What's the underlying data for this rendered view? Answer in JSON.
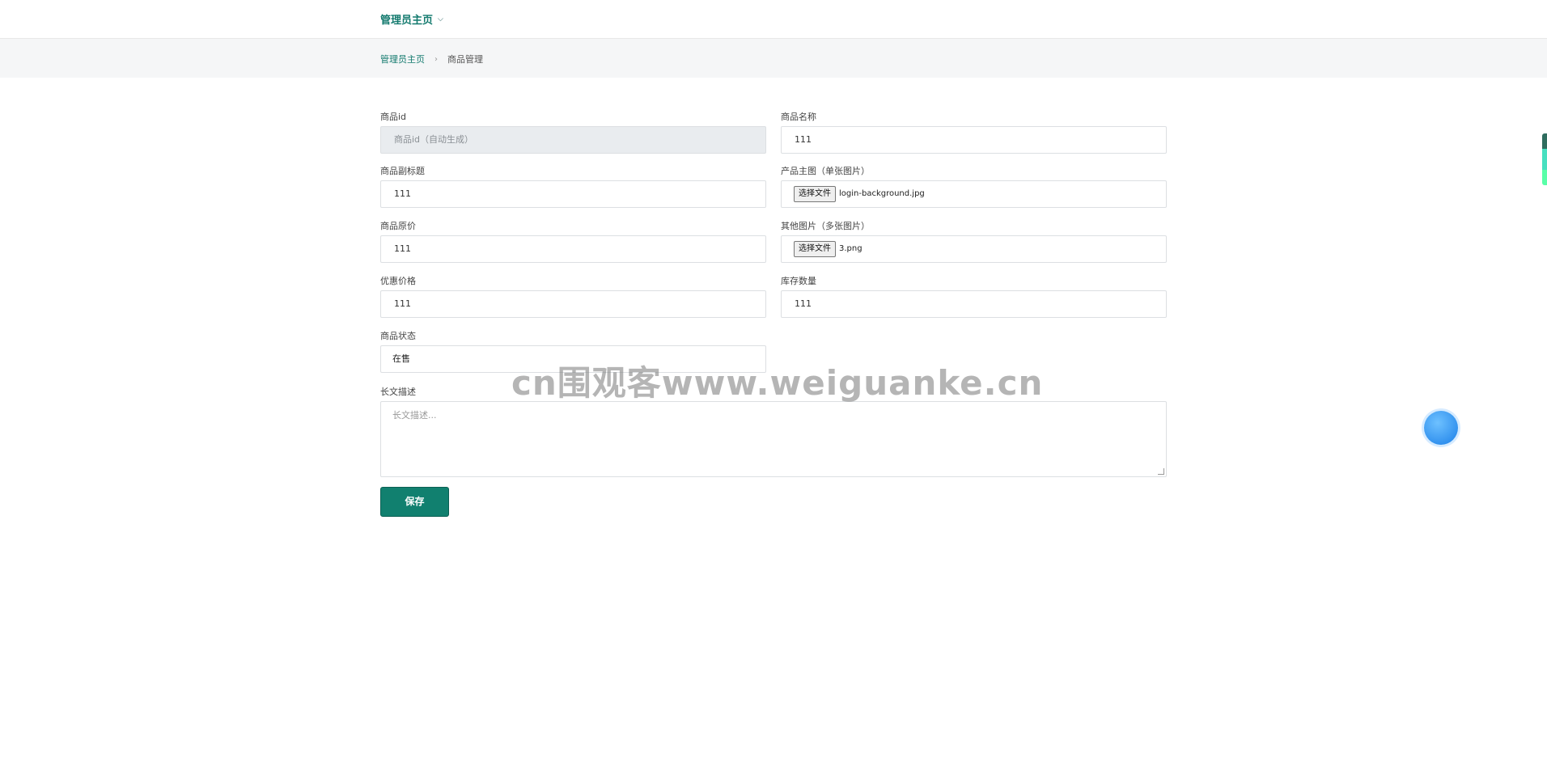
{
  "header": {
    "title": "管理员主页",
    "chevron_icon": "chevron-down-icon"
  },
  "breadcrumb": {
    "home": "管理员主页",
    "separator": "›",
    "current": "商品管理"
  },
  "form": {
    "product_id": {
      "label": "商品id",
      "placeholder": "商品id（自动生成）"
    },
    "product_name": {
      "label": "商品名称",
      "value": "111"
    },
    "subtitle": {
      "label": "商品副标题",
      "value": "111"
    },
    "main_image": {
      "label": "产品主图（单张图片）",
      "button": "选择文件",
      "file": "login-background.jpg"
    },
    "original_price": {
      "label": "商品原价",
      "value": "111"
    },
    "other_images": {
      "label": "其他图片（多张图片）",
      "button": "选择文件",
      "file": "3.png"
    },
    "discount_price": {
      "label": "优惠价格",
      "value": "111"
    },
    "stock": {
      "label": "库存数量",
      "value": "111"
    },
    "status": {
      "label": "商品状态",
      "value": "在售"
    },
    "description": {
      "label": "长文描述",
      "placeholder": "长文描述..."
    },
    "save_label": "保存"
  },
  "watermark": "cn围观客www.weiguanke.cn",
  "colors": {
    "accent": "#137a6e",
    "button": "#11806f"
  }
}
